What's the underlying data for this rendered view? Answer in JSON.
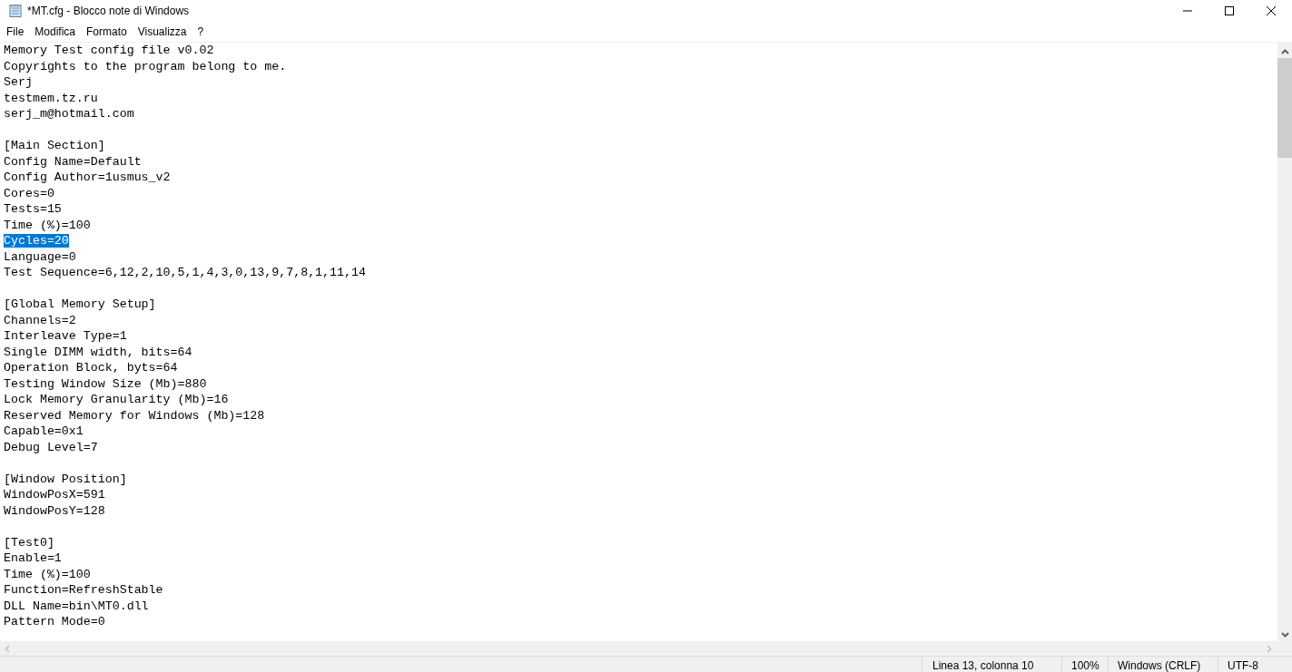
{
  "window": {
    "title": "*MT.cfg - Blocco note di Windows"
  },
  "menu": [
    "File",
    "Modifica",
    "Formato",
    "Visualizza",
    "?"
  ],
  "lines": [
    {
      "kind": "text",
      "text": "Memory Test config file v0.02",
      "selected": false
    },
    {
      "kind": "text",
      "text": "Copyrights to the program belong to me.",
      "selected": false
    },
    {
      "kind": "text",
      "text": "Serj",
      "selected": false
    },
    {
      "kind": "text",
      "text": "testmem.tz.ru",
      "selected": false
    },
    {
      "kind": "text",
      "text": "serj_m@hotmail.com",
      "selected": false
    },
    {
      "kind": "blank",
      "selected": false
    },
    {
      "kind": "text",
      "text": "[Main Section]",
      "selected": false
    },
    {
      "kind": "text",
      "text": "Config Name=Default",
      "selected": false
    },
    {
      "kind": "text",
      "text": "Config Author=1usmus_v2",
      "selected": false
    },
    {
      "kind": "text",
      "text": "Cores=0",
      "selected": false
    },
    {
      "kind": "text",
      "text": "Tests=15",
      "selected": false
    },
    {
      "kind": "text",
      "text": "Time (%)=100",
      "selected": false
    },
    {
      "kind": "text",
      "text": "Cycles=20",
      "selected": true
    },
    {
      "kind": "text",
      "text": "Language=0",
      "selected": false
    },
    {
      "kind": "text",
      "text": "Test Sequence=6,12,2,10,5,1,4,3,0,13,9,7,8,1,11,14",
      "selected": false
    },
    {
      "kind": "blank",
      "selected": false
    },
    {
      "kind": "text",
      "text": "[Global Memory Setup]",
      "selected": false
    },
    {
      "kind": "text",
      "text": "Channels=2",
      "selected": false
    },
    {
      "kind": "text",
      "text": "Interleave Type=1",
      "selected": false
    },
    {
      "kind": "text",
      "text": "Single DIMM width, bits=64",
      "selected": false
    },
    {
      "kind": "text",
      "text": "Operation Block, byts=64",
      "selected": false
    },
    {
      "kind": "text",
      "text": "Testing Window Size (Mb)=880",
      "selected": false
    },
    {
      "kind": "text",
      "text": "Lock Memory Granularity (Mb)=16",
      "selected": false
    },
    {
      "kind": "text",
      "text": "Reserved Memory for Windows (Mb)=128",
      "selected": false
    },
    {
      "kind": "text",
      "text": "Capable=0x1",
      "selected": false
    },
    {
      "kind": "text",
      "text": "Debug Level=7",
      "selected": false
    },
    {
      "kind": "blank",
      "selected": false
    },
    {
      "kind": "text",
      "text": "[Window Position]",
      "selected": false
    },
    {
      "kind": "text",
      "text": "WindowPosX=591",
      "selected": false
    },
    {
      "kind": "text",
      "text": "WindowPosY=128",
      "selected": false
    },
    {
      "kind": "blank",
      "selected": false
    },
    {
      "kind": "text",
      "text": "[Test0]",
      "selected": false
    },
    {
      "kind": "text",
      "text": "Enable=1",
      "selected": false
    },
    {
      "kind": "text",
      "text": "Time (%)=100",
      "selected": false
    },
    {
      "kind": "text",
      "text": "Function=RefreshStable",
      "selected": false
    },
    {
      "kind": "text",
      "text": "DLL Name=bin\\MT0.dll",
      "selected": false
    },
    {
      "kind": "text",
      "text": "Pattern Mode=0",
      "selected": false
    }
  ],
  "status_bar": [
    "Linea 13, colonna 10",
    "100%",
    "Windows (CRLF)",
    "UTF-8"
  ]
}
